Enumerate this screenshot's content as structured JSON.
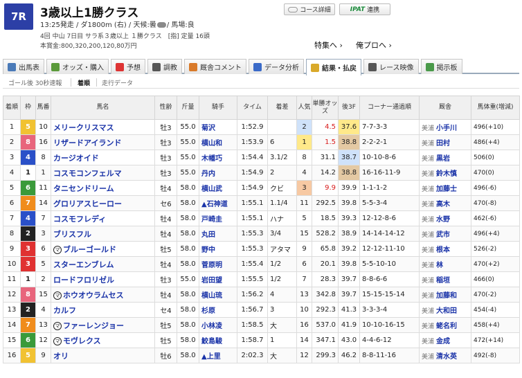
{
  "race": {
    "number": "7R",
    "title": "3歳以上1勝クラス",
    "info_before_weather": "13:25発走 / ダ1800m (右) / 天候:曇",
    "info_after_weather": "/ 馬場:良",
    "details": "4回 中山 7日目 サラ系３歳以上 １勝クラス　[指] 定量 16頭",
    "prize": "本賞金:800,320,200,120,80万円"
  },
  "buttons": {
    "course": "コース詳細",
    "ipat_logo": "IPAT",
    "ipat": "連携"
  },
  "links": {
    "feature": "特集へ ›",
    "pro": "俺プロへ ›"
  },
  "tabs": [
    {
      "label": "出馬表",
      "icon": "table-icon",
      "color": "#4a7ab8"
    },
    {
      "label": "オッズ・購入",
      "icon": "odds-icon",
      "color": "#5a9a3a"
    },
    {
      "label": "予想",
      "icon": "target-icon",
      "color": "#d33"
    },
    {
      "label": "調教",
      "icon": "stopwatch-icon",
      "color": "#555"
    },
    {
      "label": "厩舎コメント",
      "icon": "house-icon",
      "color": "#d97a2a"
    },
    {
      "label": "データ分析",
      "icon": "bar-chart-icon",
      "color": "#3a6ac8"
    },
    {
      "label": "結果・払戻",
      "icon": "coins-icon",
      "color": "#d9a92a"
    },
    {
      "label": "レース映像",
      "icon": "video-icon",
      "color": "#555"
    },
    {
      "label": "掲示板",
      "icon": "chat-icon",
      "color": "#4a9a4a"
    }
  ],
  "subtabs": [
    "ゴール後 30秒速報",
    "着順",
    "走行データ"
  ],
  "headers": [
    "着順",
    "枠",
    "馬番",
    "馬名",
    "性齢",
    "斤量",
    "騎手",
    "タイム",
    "着差",
    "人気",
    "単勝オッズ",
    "後3F",
    "コーナー通過順",
    "厩舎",
    "馬体重(増減)"
  ],
  "gate_colors": {
    "1": "#ffffff",
    "2": "#222222",
    "3": "#e03131",
    "4": "#2a50c8",
    "5": "#f1c232",
    "6": "#3a9a3a",
    "7": "#f08c1c",
    "8": "#e8657c"
  },
  "rows": [
    {
      "rank": "1",
      "gate": "5",
      "num": "10",
      "mar": "",
      "name": "メリークリスマス",
      "sex": "牡3",
      "wt": "55.0",
      "jockey": "菊沢",
      "time": "1:52.9",
      "margin": "",
      "pop": "2",
      "odds": "4.5",
      "f3": "37.6",
      "corner": "7-7-3-3",
      "stable": "美浦",
      "trainer": "小手川",
      "body": "496(+10)"
    },
    {
      "rank": "2",
      "gate": "8",
      "num": "16",
      "mar": "",
      "name": "リザードアイランド",
      "sex": "牡3",
      "wt": "55.0",
      "jockey": "横山和",
      "time": "1:53.9",
      "margin": "6",
      "pop": "1",
      "odds": "1.5",
      "f3": "38.8",
      "corner": "2-2-2-1",
      "stable": "美浦",
      "trainer": "田村",
      "body": "486(+4)"
    },
    {
      "rank": "3",
      "gate": "4",
      "num": "8",
      "mar": "",
      "name": "カージオイド",
      "sex": "牡3",
      "wt": "55.0",
      "jockey": "木幡巧",
      "time": "1:54.4",
      "margin": "3.1/2",
      "pop": "8",
      "odds": "31.1",
      "f3": "38.7",
      "corner": "10-10-8-6",
      "stable": "美浦",
      "trainer": "黒岩",
      "body": "506(0)"
    },
    {
      "rank": "4",
      "gate": "1",
      "num": "1",
      "mar": "",
      "name": "コスモコンフェルマ",
      "sex": "牡3",
      "wt": "55.0",
      "jockey": "丹内",
      "time": "1:54.9",
      "margin": "2",
      "pop": "4",
      "odds": "14.2",
      "f3": "38.8",
      "corner": "16-16-11-9",
      "stable": "美浦",
      "trainer": "鈴木慎",
      "body": "470(0)"
    },
    {
      "rank": "5",
      "gate": "6",
      "num": "11",
      "mar": "",
      "name": "タニセンドリーム",
      "sex": "牡4",
      "wt": "58.0",
      "jockey": "横山武",
      "time": "1:54.9",
      "margin": "クビ",
      "pop": "3",
      "odds": "9.9",
      "f3": "39.9",
      "corner": "1-1-1-2",
      "stable": "美浦",
      "trainer": "加藤士",
      "body": "496(-6)"
    },
    {
      "rank": "6",
      "gate": "7",
      "num": "14",
      "mar": "",
      "name": "グロリアスヒーロー",
      "sex": "セ6",
      "wt": "58.0",
      "jockey": "▲石神道",
      "time": "1:55.1",
      "margin": "1.1/4",
      "pop": "11",
      "odds": "292.5",
      "f3": "39.8",
      "corner": "5-5-3-4",
      "stable": "美浦",
      "trainer": "高木",
      "body": "470(-8)"
    },
    {
      "rank": "7",
      "gate": "4",
      "num": "7",
      "mar": "",
      "name": "コスモフレディ",
      "sex": "牡4",
      "wt": "58.0",
      "jockey": "戸崎圭",
      "time": "1:55.1",
      "margin": "ハナ",
      "pop": "5",
      "odds": "18.5",
      "f3": "39.3",
      "corner": "12-12-8-6",
      "stable": "美浦",
      "trainer": "水野",
      "body": "462(-6)"
    },
    {
      "rank": "8",
      "gate": "2",
      "num": "3",
      "mar": "",
      "name": "ブリスフル",
      "sex": "牡4",
      "wt": "58.0",
      "jockey": "丸田",
      "time": "1:55.3",
      "margin": "3/4",
      "pop": "15",
      "odds": "528.2",
      "f3": "38.9",
      "corner": "14-14-14-12",
      "stable": "美浦",
      "trainer": "武市",
      "body": "496(+4)"
    },
    {
      "rank": "9",
      "gate": "3",
      "num": "6",
      "mar": "マ",
      "name": "ブルーゴールド",
      "sex": "牡5",
      "wt": "58.0",
      "jockey": "野中",
      "time": "1:55.3",
      "margin": "アタマ",
      "pop": "9",
      "odds": "65.8",
      "f3": "39.2",
      "corner": "12-12-11-10",
      "stable": "美浦",
      "trainer": "根本",
      "body": "526(-2)"
    },
    {
      "rank": "10",
      "gate": "3",
      "num": "5",
      "mar": "",
      "name": "スターエンブレム",
      "sex": "牡4",
      "wt": "58.0",
      "jockey": "菅原明",
      "time": "1:55.4",
      "margin": "1/2",
      "pop": "6",
      "odds": "20.1",
      "f3": "39.8",
      "corner": "5-5-10-10",
      "stable": "美浦",
      "trainer": "林",
      "body": "470(+2)"
    },
    {
      "rank": "11",
      "gate": "1",
      "num": "2",
      "mar": "",
      "name": "ロードフロリゼル",
      "sex": "牡3",
      "wt": "55.0",
      "jockey": "岩田望",
      "time": "1:55.5",
      "margin": "1/2",
      "pop": "7",
      "odds": "28.3",
      "f3": "39.7",
      "corner": "8-8-6-6",
      "stable": "美浦",
      "trainer": "稲垣",
      "body": "466(0)"
    },
    {
      "rank": "12",
      "gate": "8",
      "num": "15",
      "mar": "マ",
      "name": "ホウオウラムセス",
      "sex": "牡4",
      "wt": "58.0",
      "jockey": "横山琉",
      "time": "1:56.2",
      "margin": "4",
      "pop": "13",
      "odds": "342.8",
      "f3": "39.7",
      "corner": "15-15-15-14",
      "stable": "美浦",
      "trainer": "加藤和",
      "body": "470(-2)"
    },
    {
      "rank": "13",
      "gate": "2",
      "num": "4",
      "mar": "",
      "name": "カルフ",
      "sex": "セ4",
      "wt": "58.0",
      "jockey": "杉原",
      "time": "1:56.7",
      "margin": "3",
      "pop": "10",
      "odds": "292.3",
      "f3": "41.3",
      "corner": "3-3-3-4",
      "stable": "美浦",
      "trainer": "大和田",
      "body": "454(-4)"
    },
    {
      "rank": "14",
      "gate": "7",
      "num": "13",
      "mar": "マ",
      "name": "ファーレンジョー",
      "sex": "牡5",
      "wt": "58.0",
      "jockey": "小林凌",
      "time": "1:58.5",
      "margin": "大",
      "pop": "16",
      "odds": "537.0",
      "f3": "41.9",
      "corner": "10-10-16-15",
      "stable": "美浦",
      "trainer": "蛯名利",
      "body": "458(+4)"
    },
    {
      "rank": "15",
      "gate": "6",
      "num": "12",
      "mar": "マ",
      "name": "モヴレクス",
      "sex": "牡5",
      "wt": "58.0",
      "jockey": "鮫島駿",
      "time": "1:58.7",
      "margin": "1",
      "pop": "14",
      "odds": "347.1",
      "f3": "43.0",
      "corner": "4-4-6-12",
      "stable": "美浦",
      "trainer": "金成",
      "body": "472(+14)"
    },
    {
      "rank": "16",
      "gate": "5",
      "num": "9",
      "mar": "",
      "name": "オリ",
      "sex": "牡6",
      "wt": "58.0",
      "jockey": "▲上里",
      "time": "2:02.3",
      "margin": "大",
      "pop": "12",
      "odds": "299.3",
      "f3": "46.2",
      "corner": "8-8-11-16",
      "stable": "美浦",
      "trainer": "清水英",
      "body": "492(-8)"
    }
  ],
  "highlight": {
    "pop1": "#ffe98a",
    "pop2": "#cfe2fa",
    "pop3": "#f7c9a3",
    "f3_1": "#ffe98a",
    "f3_2": "#cfe2fa",
    "f3_3": "#e4c9a3"
  }
}
